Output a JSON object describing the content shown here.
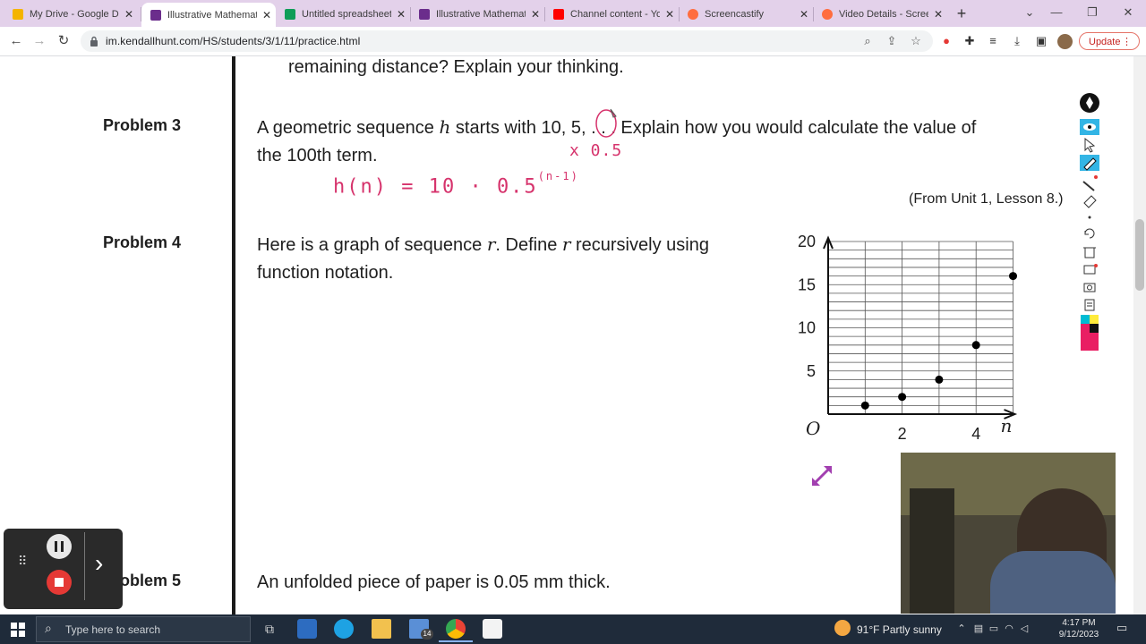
{
  "browser": {
    "tabs": [
      {
        "title": "My Drive - Google Drive",
        "favicon_color": "#f4b400",
        "active": false
      },
      {
        "title": "Illustrative Mathematics",
        "favicon_color": "#6b2d8c",
        "active": true
      },
      {
        "title": "Untitled spreadsheet",
        "favicon_color": "#0f9d58",
        "active": false
      },
      {
        "title": "Illustrative Mathematics",
        "favicon_color": "#6b2d8c",
        "active": false
      },
      {
        "title": "Channel content - YouTube",
        "favicon_color": "#ff0000",
        "active": false
      },
      {
        "title": "Screencastify",
        "favicon_color": "#ff6d3f",
        "active": false
      },
      {
        "title": "Video Details - Screencastify",
        "favicon_color": "#ff6d3f",
        "active": false
      }
    ],
    "new_tab": "+",
    "url": "im.kendallhunt.com/HS/students/3/1/11/practice.html",
    "update_label": "Update",
    "accent_color": "#e3d1ea"
  },
  "page": {
    "prev_text": "remaining distance? Explain your thinking.",
    "problem3": {
      "label": "Problem 3",
      "text_a": "A geometric sequence ",
      "var": "h",
      "text_b": " starts with 10, 5, . . . Explain how you would calculate the value of",
      "text_c": "the 100th term.",
      "source": "(From Unit 1, Lesson 8.)"
    },
    "problem4": {
      "label": "Problem 4",
      "text_a": "Here is a graph of sequence ",
      "var": "r",
      "text_b": ". Define ",
      "text_c": " recursively using",
      "text_d": "function notation."
    },
    "problem5": {
      "label": "Problem 5",
      "text": "An unfolded piece of paper is 0.05 mm thick."
    },
    "handwriting": {
      "ratio": "x 0.5",
      "formula": "h(n) = 10 · 0.5",
      "exponent": "(n-1)",
      "color": "#d6336c"
    }
  },
  "chart_data": {
    "type": "scatter",
    "x": [
      1,
      2,
      3,
      4,
      5
    ],
    "y": [
      1,
      2,
      4,
      8,
      16
    ],
    "xlim": [
      0,
      5
    ],
    "ylim": [
      0,
      20
    ],
    "x_ticks": [
      "2",
      "4"
    ],
    "y_ticks": [
      "5",
      "10",
      "15",
      "20"
    ],
    "origin_label": "O",
    "xlabel": "n",
    "grid": true
  },
  "taskbar": {
    "search_placeholder": "Type here to search",
    "weather": "91°F  Partly sunny",
    "time": "4:17 PM",
    "date": "9/12/2023",
    "mail_badge": "14"
  }
}
